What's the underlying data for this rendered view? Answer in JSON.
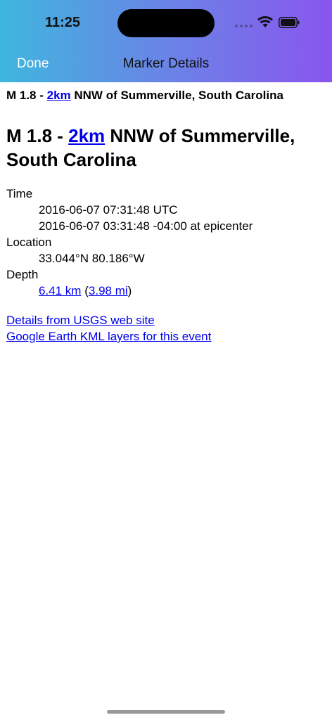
{
  "status_bar": {
    "time": "11:25"
  },
  "nav": {
    "done_label": "Done",
    "title": "Marker Details"
  },
  "event": {
    "mag_prefix": "M 1.8 - ",
    "distance_link": "2km",
    "place_suffix": " NNW of Summerville, South Carolina"
  },
  "details": {
    "time_label": "Time",
    "time_utc": "2016-06-07 07:31:48 UTC",
    "time_local": "2016-06-07 03:31:48 -04:00 at epicenter",
    "location_label": "Location",
    "location_value": "33.044°N 80.186°W",
    "depth_label": "Depth",
    "depth_km": "6.41 km",
    "depth_mi": "3.98 mi",
    "depth_open": "(",
    "depth_close": ")"
  },
  "links": {
    "usgs": "Details from USGS web site",
    "kml": "Google Earth KML layers for this event"
  },
  "colors": {
    "link": "#0000ee",
    "gradient_start": "#3fb6de",
    "gradient_end": "#8a55ef"
  }
}
